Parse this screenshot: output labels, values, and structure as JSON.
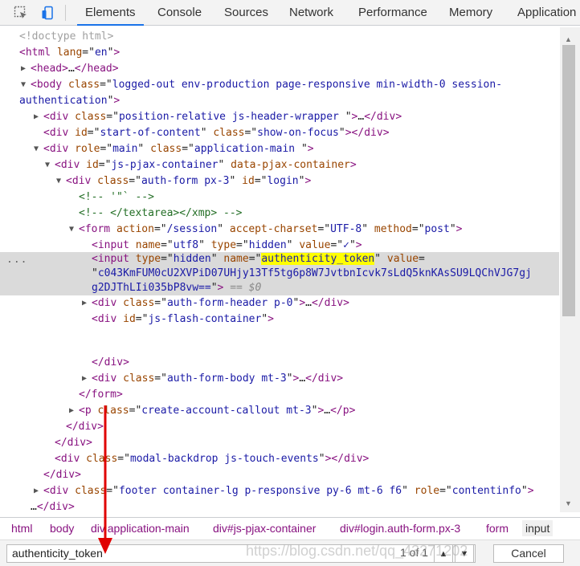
{
  "tabs": [
    "Elements",
    "Console",
    "Sources",
    "Network",
    "Performance",
    "Memory",
    "Application"
  ],
  "active_tab": "Elements",
  "tree": {
    "doctype": "<!doctype html>",
    "html_open": {
      "tag": "html",
      "attr": "lang",
      "value": "en"
    },
    "head": "head",
    "body": {
      "tag": "body",
      "attr": "class",
      "value": "logged-out env-production page-responsive min-width-0 session-",
      "value_cont": "authentication"
    },
    "header_wrapper": {
      "tag": "div",
      "attr": "class",
      "value": "position-relative js-header-wrapper "
    },
    "start_content": {
      "tag": "div",
      "attr1": "id",
      "value1": "start-of-content",
      "attr2": "class",
      "value2": "show-on-focus"
    },
    "main": {
      "tag": "div",
      "attr1": "role",
      "value1": "main",
      "attr2": "class",
      "value2": "application-main "
    },
    "pjax": {
      "tag": "div",
      "attr1": "id",
      "value1": "js-pjax-container",
      "attr2": "data-pjax-container"
    },
    "auth_form": {
      "tag": "div",
      "attr1": "class",
      "value1": "auth-form px-3",
      "attr2": "id",
      "value2": "login"
    },
    "comment1": "<!-- '\"` -->",
    "comment2": "<!-- </textarea></xmp> -->",
    "form": {
      "tag": "form",
      "attr1": "action",
      "value1": "/session",
      "attr2": "accept-charset",
      "value2": "UTF-8",
      "attr3": "method",
      "value3": "post"
    },
    "utf8_input": {
      "tag": "input",
      "attr1": "name",
      "value1": "utf8",
      "attr2": "type",
      "value2": "hidden",
      "attr3": "value",
      "value3": "✓"
    },
    "token_input": {
      "tag": "input",
      "attr1": "type",
      "value1": "hidden",
      "attr2": "name",
      "value2": "authenticity_token",
      "attr3": "value",
      "value3a": "c043KmFUM0cU2XVPiD07UHjy13Tf5tg6p8W7JvtbnIcvk7sLdQ5knKAsSU9LQChVJG7gj",
      "value3b": "g2DJThLIi035bP8vw==",
      "marker": "== $0"
    },
    "form_header": {
      "tag": "div",
      "attr": "class",
      "value": "auth-form-header p-0"
    },
    "flash": {
      "tag": "div",
      "attr": "id",
      "value": "js-flash-container"
    },
    "form_body": {
      "tag": "div",
      "attr": "class",
      "value": "auth-form-body mt-3"
    },
    "callout": {
      "tag": "p",
      "attr": "class",
      "value": "create-account-callout mt-3"
    },
    "modal": {
      "tag": "div",
      "attr": "class",
      "value": "modal-backdrop js-touch-events"
    },
    "footer": {
      "tag": "div",
      "attr1": "class",
      "value1": "footer container-lg p-responsive py-6 mt-6 f6",
      "attr2": "role",
      "value2": "contentinfo"
    },
    "ellipsis": "…",
    "dots": "..."
  },
  "breadcrumbs": [
    {
      "tag": "html",
      "rest": ""
    },
    {
      "tag": "body",
      "rest": ""
    },
    {
      "tag": "div",
      "rest": ".application-main"
    },
    {
      "tag": "div",
      "rest": "#js-pjax-container"
    },
    {
      "tag": "div",
      "rest": "#login.auth-form.px-3"
    },
    {
      "tag": "form",
      "rest": ""
    },
    {
      "tag": "input",
      "rest": ""
    }
  ],
  "search": {
    "value": "authenticity_token",
    "match_count": "1 of 1",
    "cancel_label": "Cancel"
  },
  "watermark": "https://blog.csdn.net/qq_43271202",
  "colors": {
    "tag": "#881280",
    "attr_name": "#994500",
    "attr_value": "#1a1aa6",
    "comment": "#236e25",
    "highlight": "#ffff00",
    "selection": "#dadada",
    "tab_underline": "#1a73e8",
    "annotation": "#e00000"
  },
  "icons": [
    "inspect-element-icon",
    "device-toolbar-icon",
    "scroll-up-icon",
    "scroll-down-icon",
    "chevron-up-icon",
    "chevron-down-icon"
  ]
}
